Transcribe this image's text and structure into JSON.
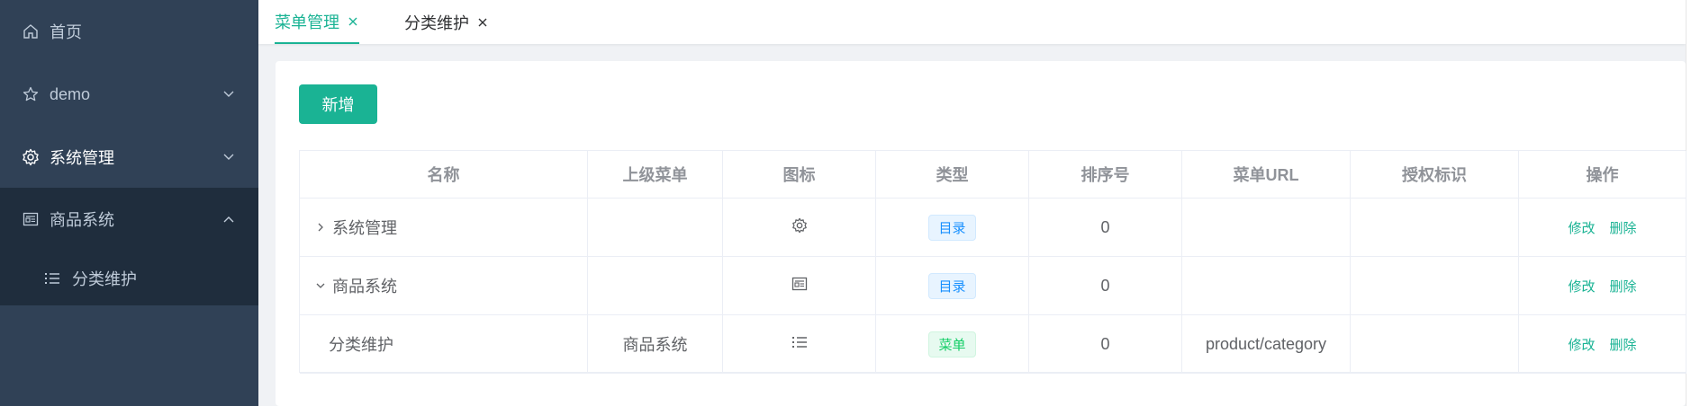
{
  "sidebar": {
    "items": [
      {
        "label": "首页",
        "icon": "home-icon"
      },
      {
        "label": "demo",
        "icon": "star-icon"
      },
      {
        "label": "系统管理",
        "icon": "gear-icon"
      },
      {
        "label": "商品系统",
        "icon": "list-box-icon"
      }
    ],
    "sub_items": [
      {
        "label": "分类维护",
        "icon": "list-icon"
      }
    ]
  },
  "tabs": [
    {
      "label": "菜单管理"
    },
    {
      "label": "分类维护"
    }
  ],
  "toolbar": {
    "add_label": "新增"
  },
  "table": {
    "headers": [
      "名称",
      "上级菜单",
      "图标",
      "类型",
      "排序号",
      "菜单URL",
      "授权标识",
      "操作"
    ],
    "rows": [
      {
        "name": "系统管理",
        "parent": "",
        "icon": "gear-icon",
        "type": "目录",
        "order": "0",
        "url": "",
        "perm": "",
        "edit": "修改",
        "delete": "删除"
      },
      {
        "name": "商品系统",
        "parent": "",
        "icon": "list-box-icon",
        "type": "目录",
        "order": "0",
        "url": "",
        "perm": "",
        "edit": "修改",
        "delete": "删除"
      },
      {
        "name": "分类维护",
        "parent": "商品系统",
        "icon": "list-icon",
        "type": "菜单",
        "order": "0",
        "url": "product/category",
        "perm": "",
        "edit": "修改",
        "delete": "删除"
      }
    ]
  },
  "colors": {
    "accent": "#1ab394",
    "sidebar_bg": "#304156",
    "submenu_bg": "#1f2d3d",
    "tag_dir": "#1890ff",
    "tag_menu": "#13ce66"
  }
}
